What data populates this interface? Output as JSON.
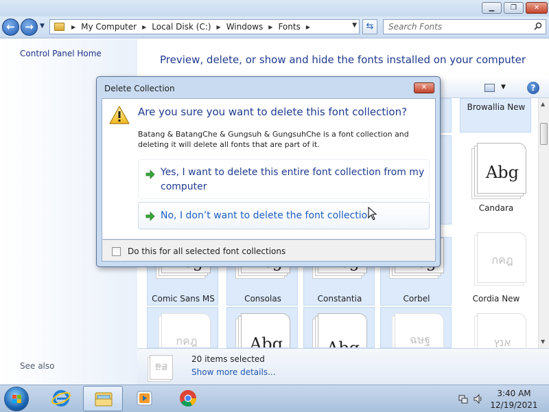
{
  "window": {
    "minimize_icon": "minimize-icon",
    "maximize_icon": "maximize-icon",
    "close_icon": "close-icon"
  },
  "nav": {
    "breadcrumbs": [
      "My Computer",
      "Local Disk (C:)",
      "Windows",
      "Fonts"
    ],
    "search_placeholder": "Search Fonts"
  },
  "left_pane": {
    "control_panel_home": "Control Panel Home",
    "see_also": "See also"
  },
  "main": {
    "heading": "Preview, delete, or show and hide the fonts installed on your computer",
    "tiles": {
      "browallia": {
        "name": "Browallia New"
      },
      "candara": {
        "name": "Candara",
        "sample": "Abg"
      },
      "comic": {
        "name": "Comic Sans MS",
        "sample": "Abg"
      },
      "consolas": {
        "name": "Consolas",
        "sample": "Abg"
      },
      "constantia": {
        "name": "Constantia",
        "sample": "Abg"
      },
      "corbel": {
        "name": "Corbel",
        "sample": "Abg"
      },
      "cordia": {
        "name": "Cordia New",
        "sample": "กคฎ"
      },
      "r5c1": {
        "sample": "กคฎ"
      },
      "r5c2": {
        "sample": "Abg"
      },
      "r5c3": {
        "sample": "Abg"
      },
      "r5c4": {
        "sample": "ฉษฐ"
      },
      "r5c5": {
        "sample": "אנץ"
      }
    }
  },
  "details": {
    "thumb_text": "한글",
    "count_text": "20 items selected",
    "more_link": "Show more details..."
  },
  "dialog": {
    "title": "Delete Collection",
    "question": "Are you sure you want to delete this font collection?",
    "description": "Batang & BatangChe & Gungsuh & GungsuhChe is a font collection and deleting it will delete all fonts that are part of it.",
    "option_yes": "Yes, I want to delete this entire font collection from my computer",
    "option_no": "No, I don’t want to delete the font collection",
    "checkbox_label": "Do this for all selected font collections",
    "checkbox_checked": false
  },
  "taskbar": {
    "time": "3:40 AM",
    "date": "12/19/2021"
  },
  "colors": {
    "heading_blue": "#1e3a8f",
    "link_blue": "#1e5fc2",
    "selection": "#dceafc",
    "close_red": "#c5432b"
  }
}
